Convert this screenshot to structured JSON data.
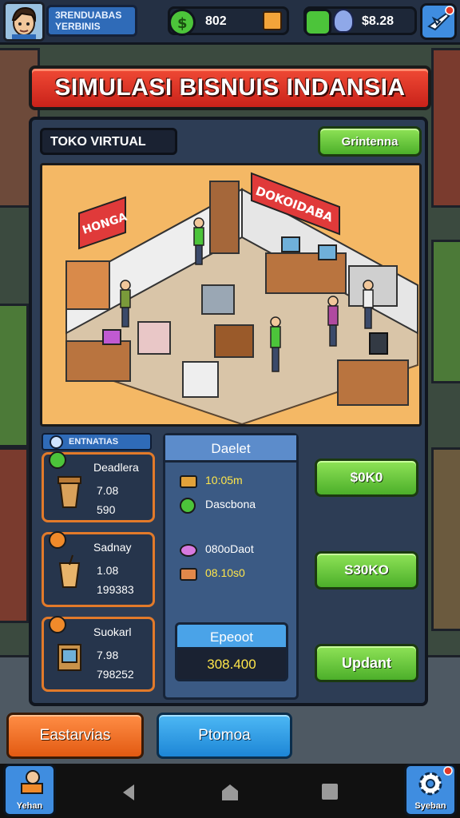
{
  "player": {
    "line1": "3RENDUABAS",
    "line2": "YERBINIS"
  },
  "resources": [
    {
      "value": "802",
      "icon": "cash-icon"
    },
    {
      "value": "$8.28",
      "icon": "potion-icon"
    }
  ],
  "title": "SIMULASI BISNUIS INDANSIA",
  "panel": {
    "header_label": "TOKO VIRTUAL",
    "header_button": "Grintenna",
    "scene_signs": {
      "left": "HONGA",
      "right": "DOKOIDABA"
    }
  },
  "stats": {
    "tag": "ENTNATIAS",
    "cards": [
      {
        "name": "Deadlera",
        "v1": "7.08",
        "v2": "590",
        "icon": "coffee-cup-icon"
      },
      {
        "name": "Sadnay",
        "v1": "1.08",
        "v2": "199383",
        "icon": "drink-cup-icon"
      },
      {
        "name": "Suokarl",
        "v1": "7.98",
        "v2": "798252",
        "icon": "cash-register-icon"
      }
    ]
  },
  "info": {
    "header": "Daelet",
    "rows": [
      {
        "text": "10:05m",
        "icon": "gold-bar-icon",
        "highlight": true
      },
      {
        "text": "Dascbona",
        "icon": "gear-icon",
        "highlight": false
      },
      {
        "text": "080oDaot",
        "icon": "flower-icon",
        "highlight": false
      },
      {
        "text": "08.10s0",
        "icon": "bread-icon",
        "highlight": true
      }
    ],
    "expect_label": "Epeoot",
    "expect_value": "308.400"
  },
  "actions": {
    "btn1": "$0K0",
    "btn2": "S30KO",
    "btn3": "Updant"
  },
  "bottom": {
    "orange": "Eastarvias",
    "blue": "Ptomoa"
  },
  "nav": {
    "left_label": "Yehan",
    "right_label": "Syeban"
  },
  "colors": {
    "title_red": "#e2342a",
    "green_button": "#6fcf3a",
    "panel_bg": "#2d3d55",
    "accent_orange": "#e27a2a"
  }
}
